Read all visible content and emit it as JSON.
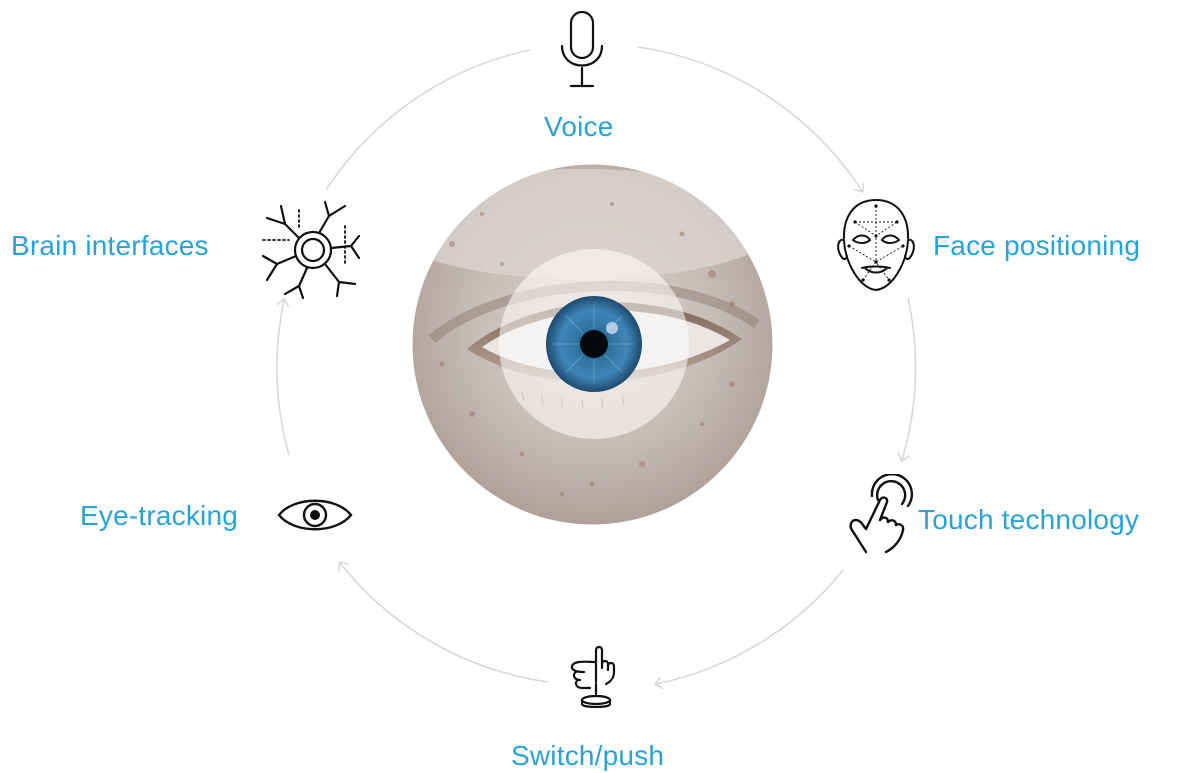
{
  "diagram": {
    "accent_color": "#29a3d6",
    "arrow_color": "#d8d8d8",
    "icon_color": "#111111",
    "center": {
      "image": "close-up of a human eye",
      "icon": "eye-closeup-photo"
    },
    "nodes": [
      {
        "id": "voice",
        "label": "Voice",
        "icon": "microphone-icon"
      },
      {
        "id": "face",
        "label": "Face positioning",
        "icon": "face-mesh-icon"
      },
      {
        "id": "touch",
        "label": "Touch technology",
        "icon": "touch-finger-icon"
      },
      {
        "id": "switch",
        "label": "Switch/push",
        "icon": "push-button-icon"
      },
      {
        "id": "eye",
        "label": "Eye-tracking",
        "icon": "eye-icon"
      },
      {
        "id": "brain",
        "label": "Brain interfaces",
        "icon": "neuron-icon"
      }
    ]
  }
}
